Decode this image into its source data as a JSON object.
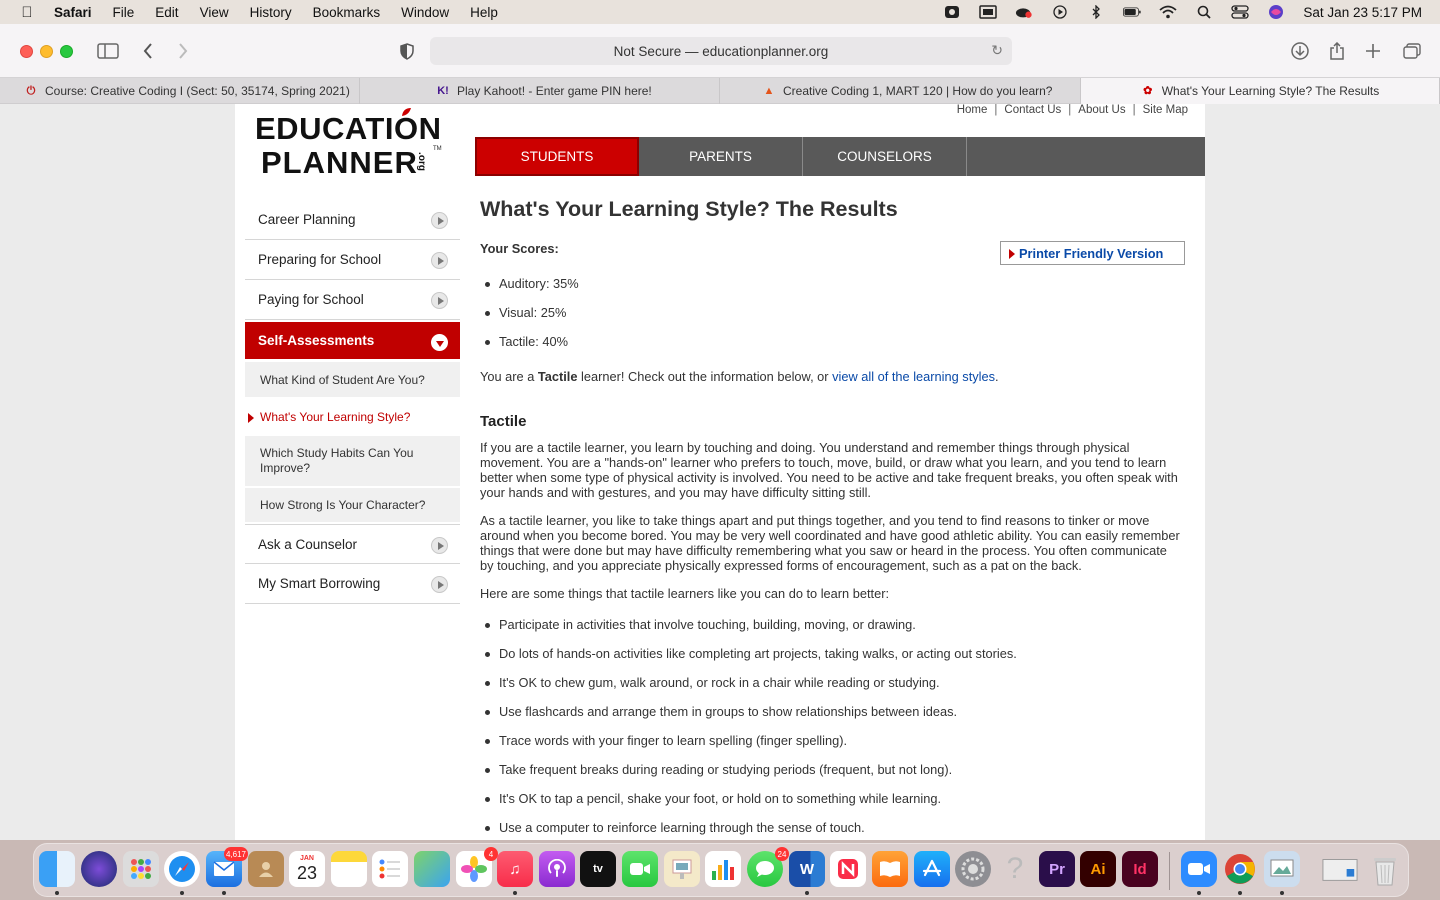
{
  "menubar": {
    "app": "Safari",
    "items": [
      "File",
      "Edit",
      "View",
      "History",
      "Bookmarks",
      "Window",
      "Help"
    ],
    "clock": "Sat Jan 23  5:17 PM"
  },
  "browser": {
    "url": "Not Secure — educationplanner.org",
    "tabs": [
      {
        "title": "Course: Creative Coding I (Sect: 50, 35174, Spring 2021)",
        "icon": "power-icon"
      },
      {
        "title": "Play Kahoot! - Enter game PIN here!",
        "icon": "kahoot-icon"
      },
      {
        "title": "Creative Coding 1, MART 120 | How do you learn?",
        "icon": "canvas-icon"
      },
      {
        "title": "What's Your Learning Style? The Results",
        "icon": "apple-icon"
      }
    ]
  },
  "site": {
    "top_links": [
      "Home",
      "Contact Us",
      "About Us",
      "Site Map"
    ],
    "logo_line1": "EDUCATION",
    "logo_line2": "PLANNER",
    "logo_suffix": ".org",
    "logo_tm": "TM",
    "nav_tabs": [
      "STUDENTS",
      "PARENTS",
      "COUNSELORS"
    ],
    "sidebar": {
      "items": [
        "Career Planning",
        "Preparing for School",
        "Paying for School",
        "Self-Assessments"
      ],
      "sub_items": [
        "What Kind of Student Are You?",
        "What's Your Learning Style?",
        "Which Study Habits Can You Improve?",
        "How Strong Is Your Character?"
      ],
      "after_items": [
        "Ask a Counselor",
        "My Smart Borrowing"
      ]
    }
  },
  "article": {
    "title": "What's Your Learning Style? The Results",
    "scores_label": "Your Scores:",
    "printer_label": "Printer Friendly Version",
    "scores": [
      "Auditory: 35%",
      "Visual: 25%",
      "Tactile: 40%"
    ],
    "result_prefix": "You are a ",
    "result_bold": "Tactile",
    "result_mid": " learner! Check out the information below, or ",
    "result_link": "view all of the learning styles",
    "result_end": ".",
    "section_heading": "Tactile",
    "para1": "If you are a tactile learner, you learn by touching and doing. You understand and remember things through physical movement. You are a \"hands-on\" learner who prefers to touch, move, build, or draw what you learn, and you tend to learn better when some type of physical activity is involved. You need to be active and take frequent breaks, you often speak with your hands and with gestures, and you may have difficulty sitting still.",
    "para2": "As a tactile learner, you like to take things apart and put things together, and you tend to find reasons to tinker or move around when you become bored. You may be very well coordinated and have good athletic ability. You can easily remember things that were done but may have difficulty remembering what you saw or heard in the process. You often communicate by touching, and you appreciate physically expressed forms of encouragement, such as a pat on the back.",
    "para3": "Here are some things that tactile learners like you can do to learn better:",
    "tips": [
      "Participate in activities that involve touching, building, moving, or drawing.",
      "Do lots of hands-on activities like completing art projects, taking walks, or acting out stories.",
      "It's OK to chew gum, walk around, or rock in a chair while reading or studying.",
      "Use flashcards and arrange them in groups to show relationships between ideas.",
      "Trace words with your finger to learn spelling (finger spelling).",
      "Take frequent breaks during reading or studying periods (frequent, but not long).",
      "It's OK to tap a pencil, shake your foot, or hold on to something while learning.",
      "Use a computer to reinforce learning through the sense of touch."
    ]
  },
  "dock": {
    "badges": {
      "mail": "4,617",
      "photos": "4",
      "messages": "24"
    },
    "calendar_month": "JAN",
    "calendar_day": "23",
    "labels": {
      "premiere": "Pr",
      "illustrator": "Ai",
      "indesign": "Id",
      "word": "W"
    }
  }
}
